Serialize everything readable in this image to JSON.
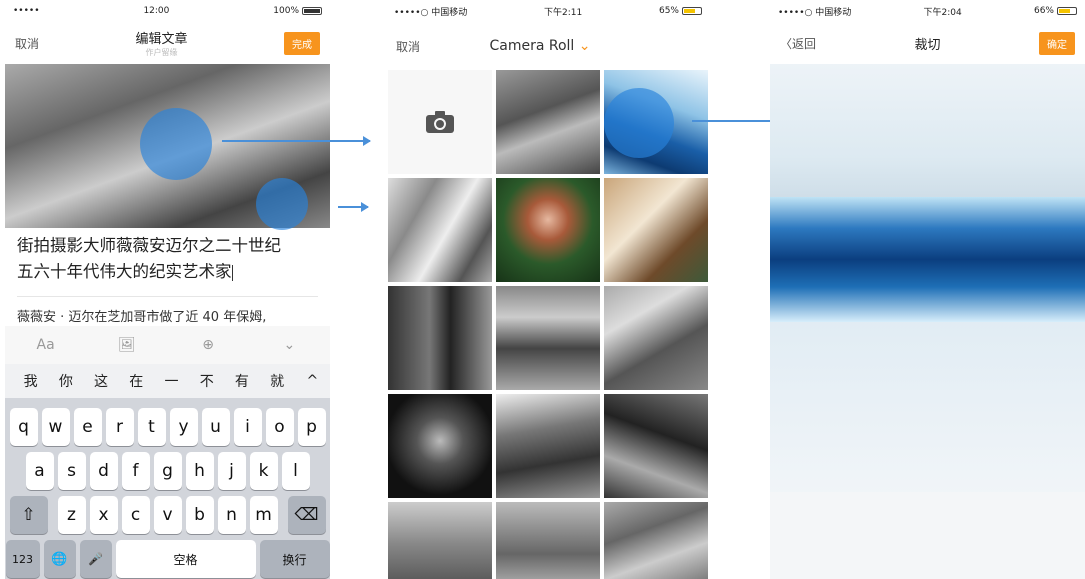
{
  "phone1": {
    "status": {
      "carrier": "•••••",
      "time": "12:00",
      "battery": "100%"
    },
    "nav": {
      "cancel": "取消",
      "title": "编辑文章",
      "subtitle": "作户留缘",
      "done": "完成"
    },
    "headline_line1": "街拍摄影大师薇薇安迈尔之二十世纪",
    "headline_line2": "五六十年代伟大的纪实艺术家",
    "body_text": "薇薇安 · 迈尔在芝加哥市做了近 40 年保姆,",
    "tools": [
      "Aa",
      "🖼",
      "⊕",
      "⌄"
    ],
    "suggestions": [
      "我",
      "你",
      "这",
      "在",
      "一",
      "不",
      "有",
      "就",
      "^"
    ],
    "keys_row1": [
      "q",
      "w",
      "e",
      "r",
      "t",
      "y",
      "u",
      "i",
      "o",
      "p"
    ],
    "keys_row2": [
      "a",
      "s",
      "d",
      "f",
      "g",
      "h",
      "j",
      "k",
      "l"
    ],
    "keys_row3": [
      "z",
      "x",
      "c",
      "v",
      "b",
      "n",
      "m"
    ],
    "key_shift": "⇧",
    "key_delete": "⌫",
    "key_123": "123",
    "key_globe": "🌐",
    "key_mic": "🎤",
    "key_space": "空格",
    "key_return": "换行"
  },
  "phone2": {
    "status": {
      "carrier": "•••••○ 中国移动",
      "time": "下午2:11",
      "battery": "65%"
    },
    "nav": {
      "cancel": "取消",
      "title": "Camera Roll",
      "chevron": "⌄"
    },
    "camera_icon": "camera-icon"
  },
  "phone3": {
    "status": {
      "carrier": "•••••○ 中国移动",
      "time": "下午2:04",
      "battery": "66%"
    },
    "nav": {
      "back": "〈返回",
      "title": "裁切",
      "confirm": "确定"
    }
  },
  "colors": {
    "accent": "#f7941d",
    "arrow": "#4a90d9"
  }
}
